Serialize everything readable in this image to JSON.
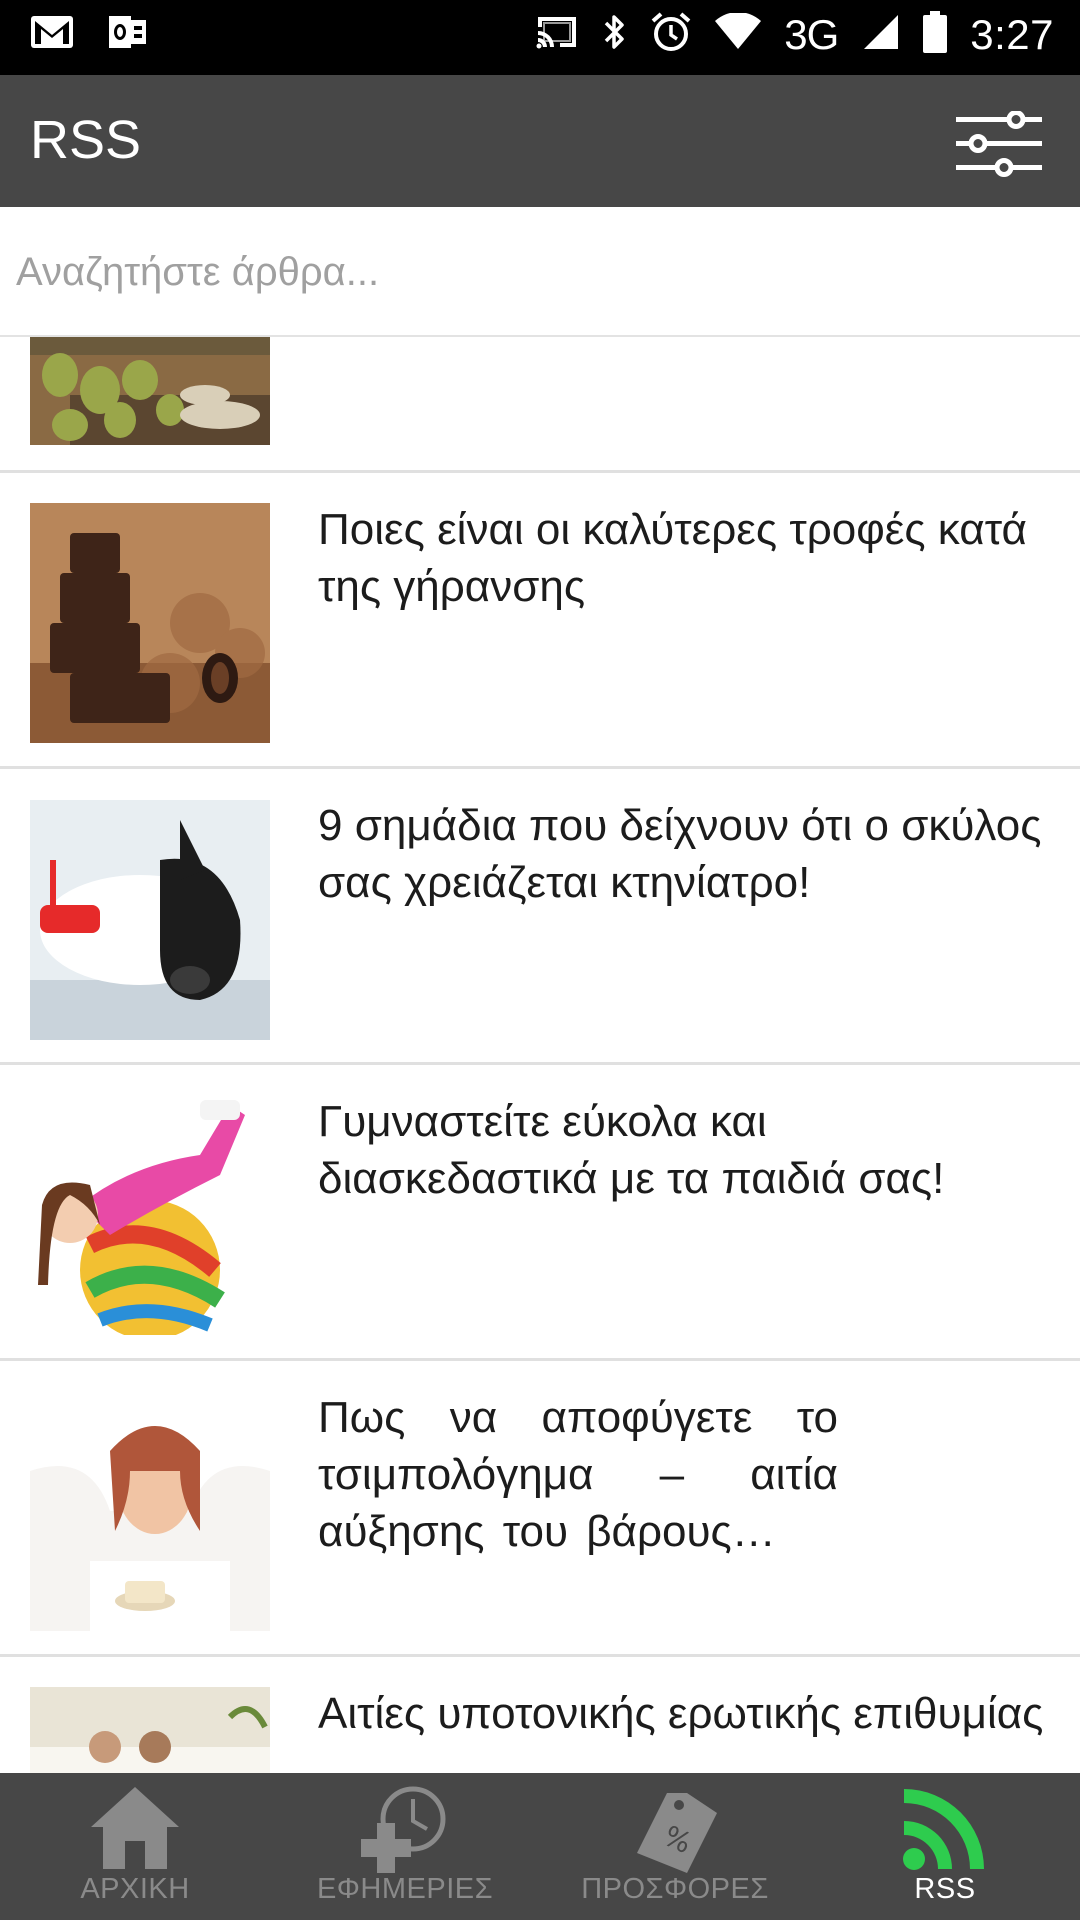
{
  "status_bar": {
    "time": "3:27",
    "network": "3G",
    "icons": [
      "gmail-icon",
      "outlook-icon",
      "cast-icon",
      "bluetooth-icon",
      "alarm-icon",
      "wifi-icon",
      "signal-icon",
      "battery-icon"
    ]
  },
  "app_bar": {
    "title": "RSS",
    "filter_icon": "sliders-icon"
  },
  "search": {
    "placeholder": "Αναζητήστε άρθρα..."
  },
  "articles": [
    {
      "title": "",
      "image": "hops-grains"
    },
    {
      "title": "Ποιες είναι οι καλύτερες τροφές κατά της γήρανσης",
      "image": "chocolate"
    },
    {
      "title": "9 σημάδια που δείχνουν ότι ο σκύλος σας χρειάζεται κτηνίατρο!",
      "image": "dog-vet"
    },
    {
      "title": "Γυμναστείτε εύκολα και διασκεδαστικά με τα παιδιά σας!",
      "image": "girl-exercise-ball"
    },
    {
      "title": "Πως να αποφύγετε το τσιμπολόγημα – αιτία αύξησης του βάρους…",
      "image": "woman-snacking"
    },
    {
      "title": "Αιτίες υποτονικής ερωτικής επιθυμίας",
      "image": "couple-bed"
    }
  ],
  "bottom_nav": {
    "items": [
      {
        "label": "ΑΡΧΙΚΗ",
        "icon": "home-icon",
        "active": false
      },
      {
        "label": "ΕΦΗΜΕΡΙΕΣ",
        "icon": "medical-clock-icon",
        "active": false
      },
      {
        "label": "ΠΡΟΣΦΟΡΕΣ",
        "icon": "discount-tag-icon",
        "active": false
      },
      {
        "label": "RSS",
        "icon": "rss-icon",
        "active": true
      }
    ]
  },
  "colors": {
    "app_bar": "#474747",
    "active_accent": "#2ecc4e",
    "inactive_icon": "#8a8a8a"
  }
}
